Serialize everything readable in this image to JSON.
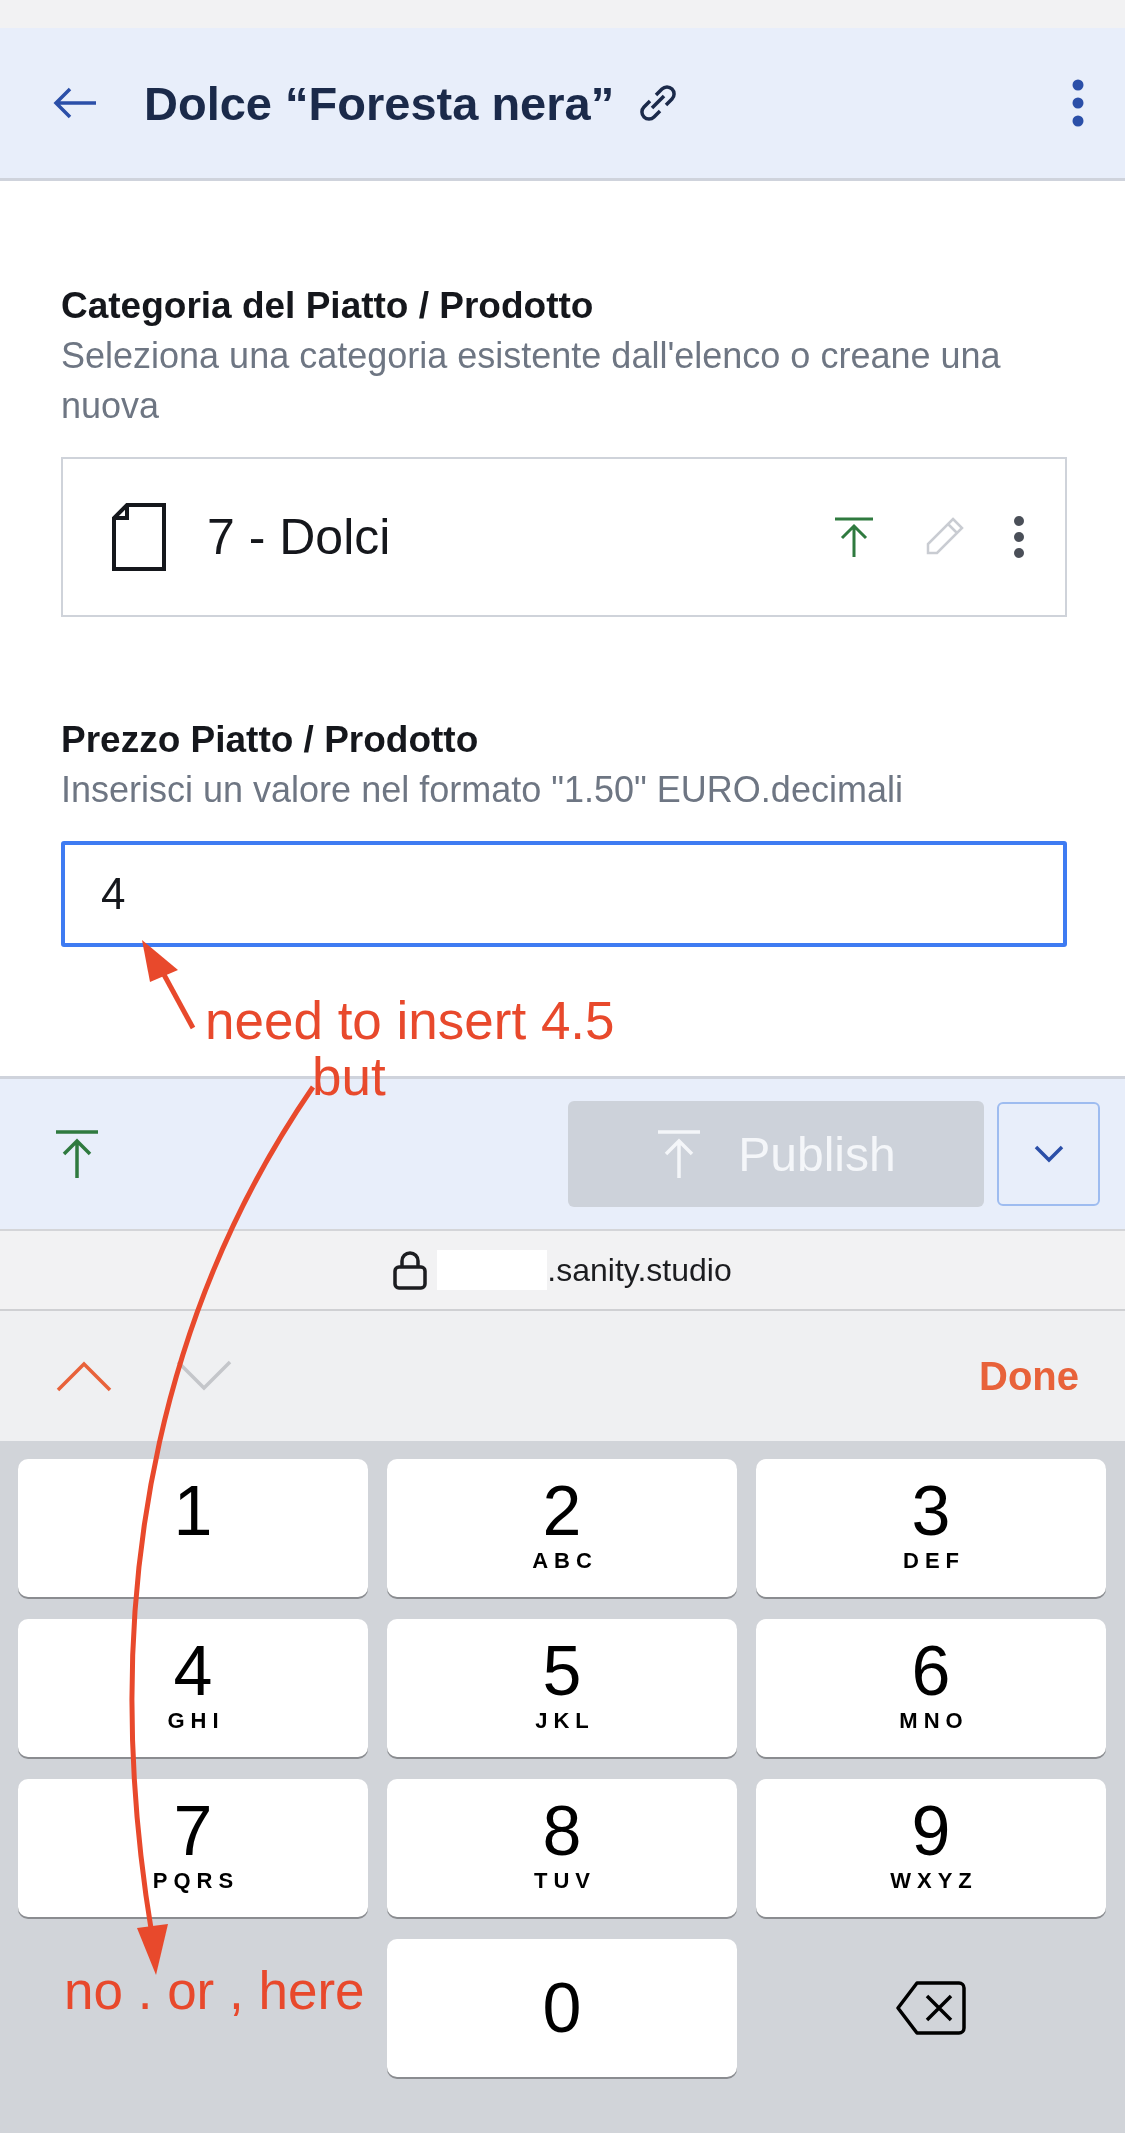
{
  "header": {
    "title": "Dolce “Foresta nera”"
  },
  "fields": [
    {
      "kind": "reference",
      "label": "Categoria del Piatto / Prodotto",
      "description": "Seleziona una categoria esistente dall'elenco o creane una nuova",
      "value": "7 - Dolci"
    },
    {
      "kind": "text",
      "label": "Prezzo Piatto / Prodotto",
      "description": "Inserisci un valore nel formato \"1.50\" EURO.decimali",
      "value": "4",
      "focused": true
    }
  ],
  "footer": {
    "publish_label": "Publish",
    "publish_disabled": true
  },
  "address_bar": {
    "domain": ".sanity.studio"
  },
  "keyboard_toolbar": {
    "previous_enabled": true,
    "next_enabled": false,
    "done_label": "Done"
  },
  "keys": [
    {
      "kind": "digit",
      "digit": "1"
    },
    {
      "kind": "digit",
      "digit": "2",
      "letters": "ABC"
    },
    {
      "kind": "digit",
      "digit": "3",
      "letters": "DEF"
    },
    {
      "kind": "digit",
      "digit": "4",
      "letters": "GHI"
    },
    {
      "kind": "digit",
      "digit": "5",
      "letters": "JKL"
    },
    {
      "kind": "digit",
      "digit": "6",
      "letters": "MNO"
    },
    {
      "kind": "digit",
      "digit": "7",
      "letters": "PQRS"
    },
    {
      "kind": "digit",
      "digit": "8",
      "letters": "TUV"
    },
    {
      "kind": "digit",
      "digit": "9",
      "letters": "WXYZ"
    },
    {
      "kind": "blank"
    },
    {
      "kind": "digit",
      "digit": "0"
    },
    {
      "kind": "delete"
    }
  ],
  "annotations": [
    {
      "text": "need to insert 4.5"
    },
    {
      "text": "but"
    },
    {
      "text": "no . or , here"
    }
  ]
}
